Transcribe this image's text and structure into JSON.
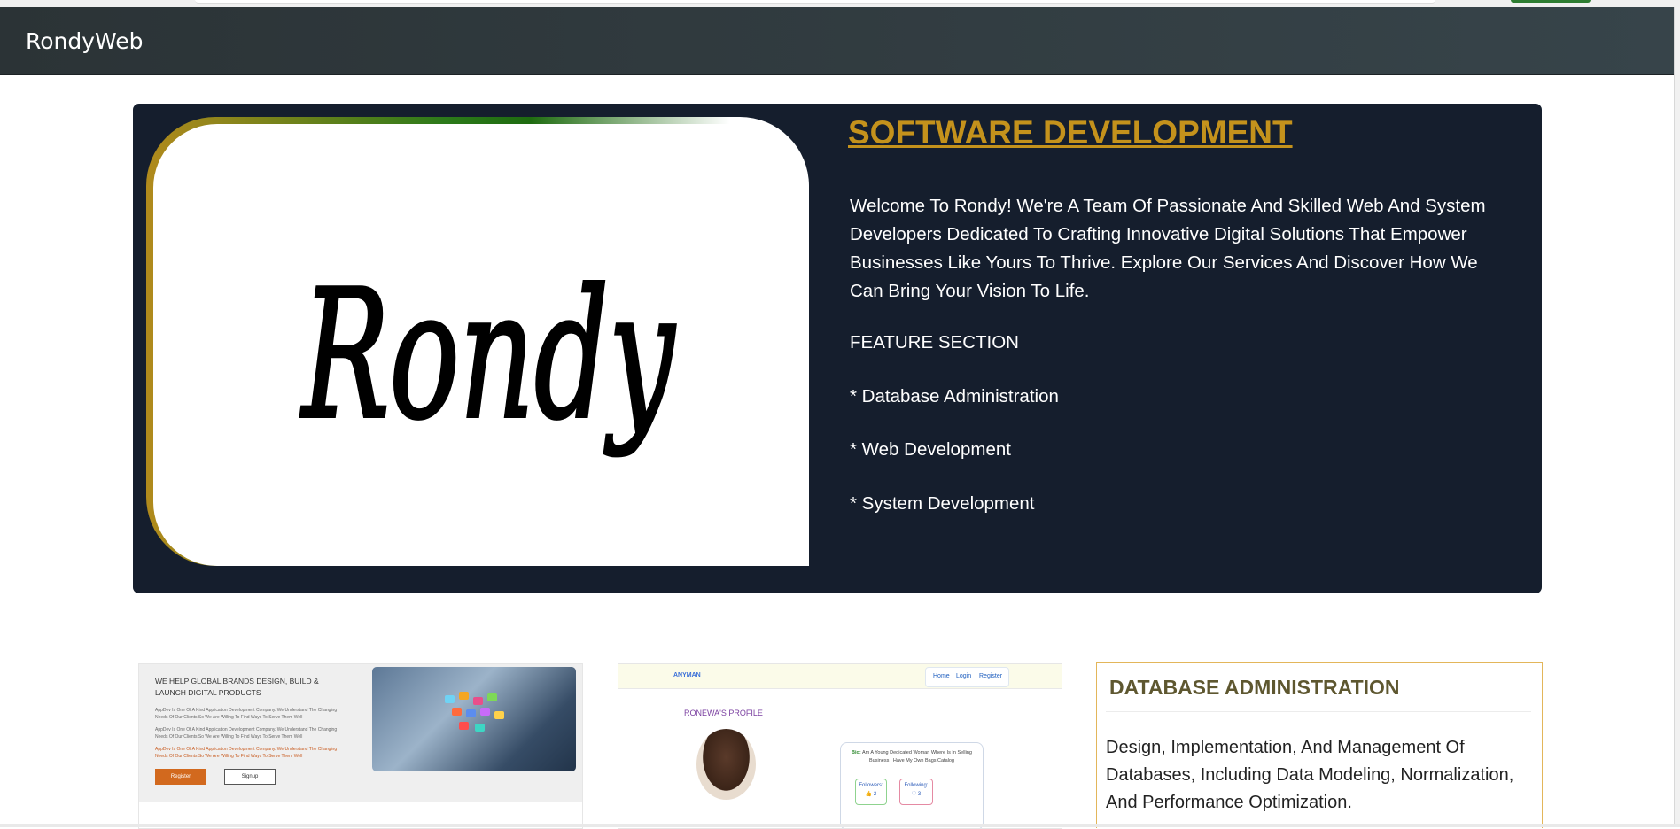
{
  "navbar": {
    "brand": "RondyWeb"
  },
  "hero": {
    "logo_text": "Rondy",
    "title": "SOFTWARE DEVELOPMENT",
    "description": "Welcome To Rondy! We're A Team Of Passionate And Skilled Web And System Developers Dedicated To Crafting Innovative Digital Solutions That Empower Businesses Like Yours To Thrive. Explore Our Services And Discover How We Can Bring Your Vision To Life.",
    "feature_heading": "FEATURE SECTION",
    "features": [
      "* Database Administration",
      "* Web Development",
      "* System Development"
    ],
    "colors": {
      "background": "#151e2d",
      "title": "#c4921c"
    }
  },
  "preview1": {
    "title": "We Help Global Brands Design, Build & Launch Digital Products",
    "lines": [
      "AppDev Is One Of A Kind Application Development Company. We Understand The Changing Needs Of Our Clients So We Are Willing To Find Ways To Serve Them Well",
      "AppDev Is One Of A Kind Application Development Company. We Understand The Changing Needs Of Our Clients So We Are Willing To Find Ways To Serve Them Well",
      "AppDev Is One Of A Kind Application Development Company. We Understand The Changing Needs Of Our Clients So We Are Willing To Find Ways To Serve Them Well"
    ],
    "register_label": "Register",
    "signup_label": "Signup"
  },
  "preview2": {
    "brand": "ANYMAN",
    "nav": [
      "Home",
      "Login",
      "Register"
    ],
    "profile_title": "RONEWA'S PROFILE",
    "bio_label": "Bio:",
    "bio": "Am A Young Dedicated Woman Where Is In Selling Business I Have My Own Bags Catalog",
    "followers_label": "Followers:",
    "followers_value": "👍 2",
    "following_label": "Following:",
    "following_value": "♡ 3"
  },
  "db_card": {
    "title": "DATABASE ADMINISTRATION",
    "body": "Design, Implementation, And Management Of Databases, Including Data Modeling, Normalization, And Performance Optimization.",
    "border_color": "#e3b65a"
  }
}
